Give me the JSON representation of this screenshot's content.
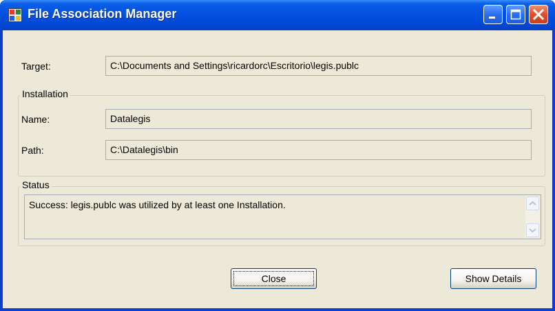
{
  "window": {
    "title": "File Association Manager",
    "icon": "application-window-icon",
    "controls": [
      "minimize-icon",
      "maximize-icon",
      "close-icon"
    ]
  },
  "form": {
    "target_label": "Target:",
    "target_value": "C:\\Documents and Settings\\ricardorc\\Escritorio\\legis.publc"
  },
  "installation": {
    "group_label": "Installation",
    "name_label": "Name:",
    "name_value": "Datalegis",
    "path_label": "Path:",
    "path_value": "C:\\Datalegis\\bin"
  },
  "status": {
    "group_label": "Status",
    "message": "Success: legis.publc was utilized by at least one Installation."
  },
  "buttons": {
    "close_label": "Close",
    "show_details_label": "Show Details"
  },
  "colors": {
    "titlebar": "#0550e0",
    "client_bg": "#ece9d8",
    "close_button": "#e0502a"
  }
}
